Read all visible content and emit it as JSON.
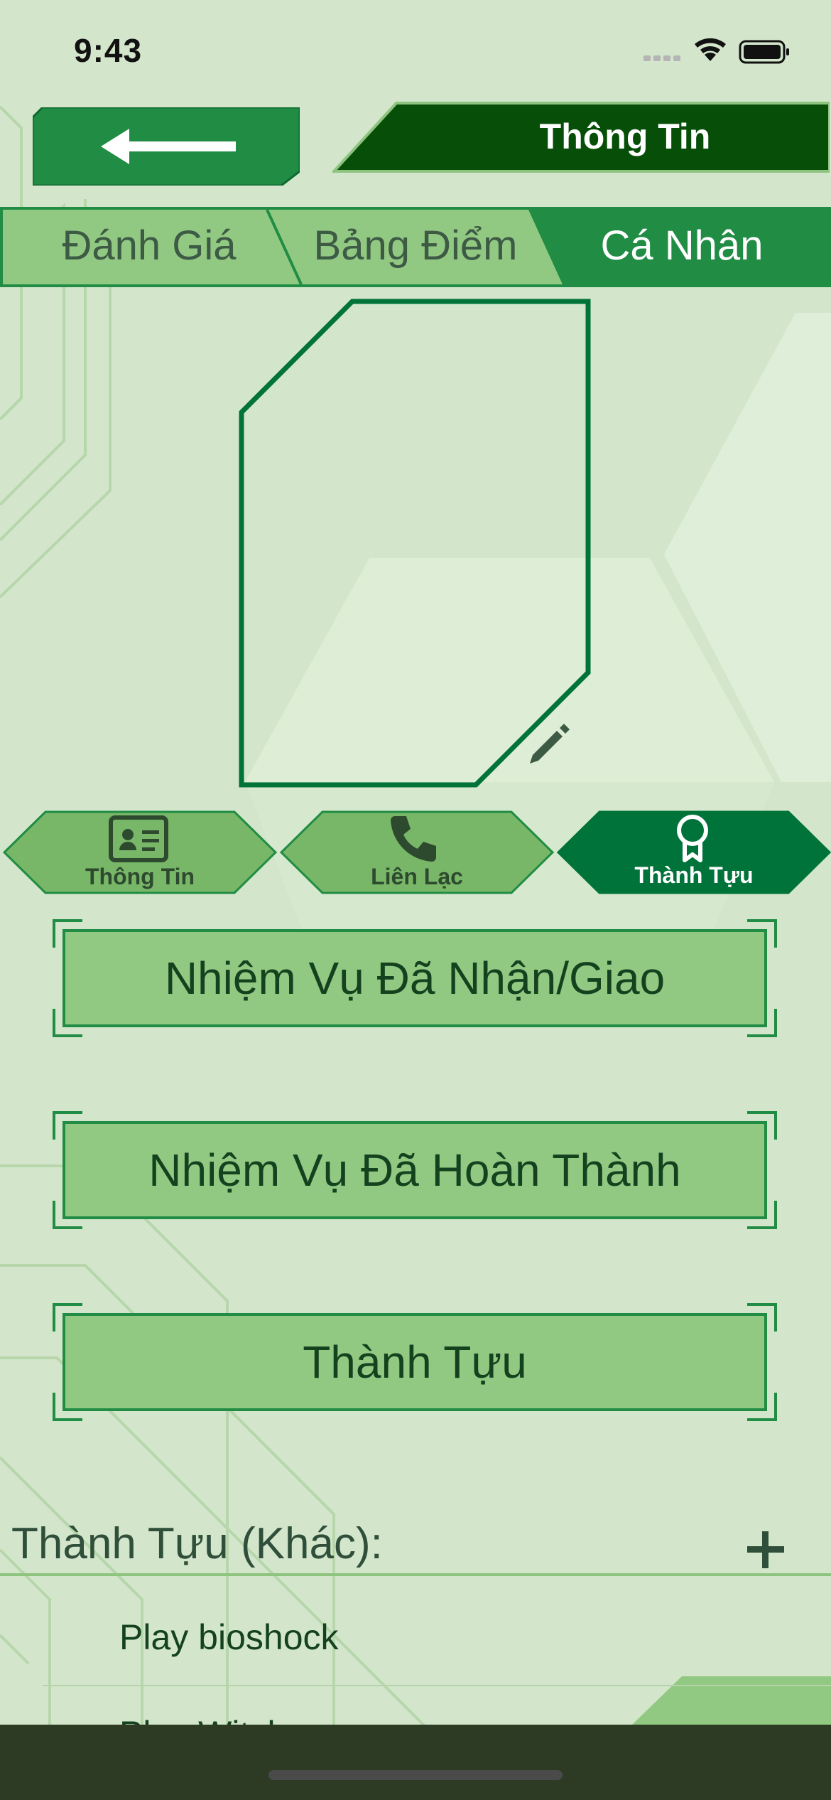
{
  "status_bar": {
    "time": "9:43"
  },
  "header": {
    "back_icon": "arrow-left-icon",
    "title": "Thông Tin"
  },
  "tabs": [
    {
      "label": "Đánh Giá",
      "active": false
    },
    {
      "label": "Bảng Điểm",
      "active": false
    },
    {
      "label": "Cá Nhân",
      "active": true
    }
  ],
  "avatar": {
    "edit_icon": "pencil-icon"
  },
  "sub_tabs": [
    {
      "label": "Thông Tin",
      "icon": "contact-card-icon",
      "active": false
    },
    {
      "label": "Liên Lạc",
      "icon": "phone-icon",
      "active": false
    },
    {
      "label": "Thành Tựu",
      "icon": "award-ribbon-icon",
      "active": true
    }
  ],
  "actions": [
    {
      "label": "Nhiệm Vụ Đã Nhận/Giao"
    },
    {
      "label": "Nhiệm Vụ Đã Hoàn Thành"
    },
    {
      "label": "Thành Tựu"
    }
  ],
  "other_achievements": {
    "title": "Thành Tựu (Khác):",
    "add_icon": "plus-icon",
    "items": [
      "Play bioshock",
      "Play Witch"
    ]
  },
  "colors": {
    "background": "#d3e6cb",
    "dark_green": "#074f08",
    "primary_green": "#218c44",
    "light_green": "#92c982",
    "hex_green": "#79b768",
    "active_hex": "#00733a",
    "bottom_bar": "#2d3a24"
  }
}
